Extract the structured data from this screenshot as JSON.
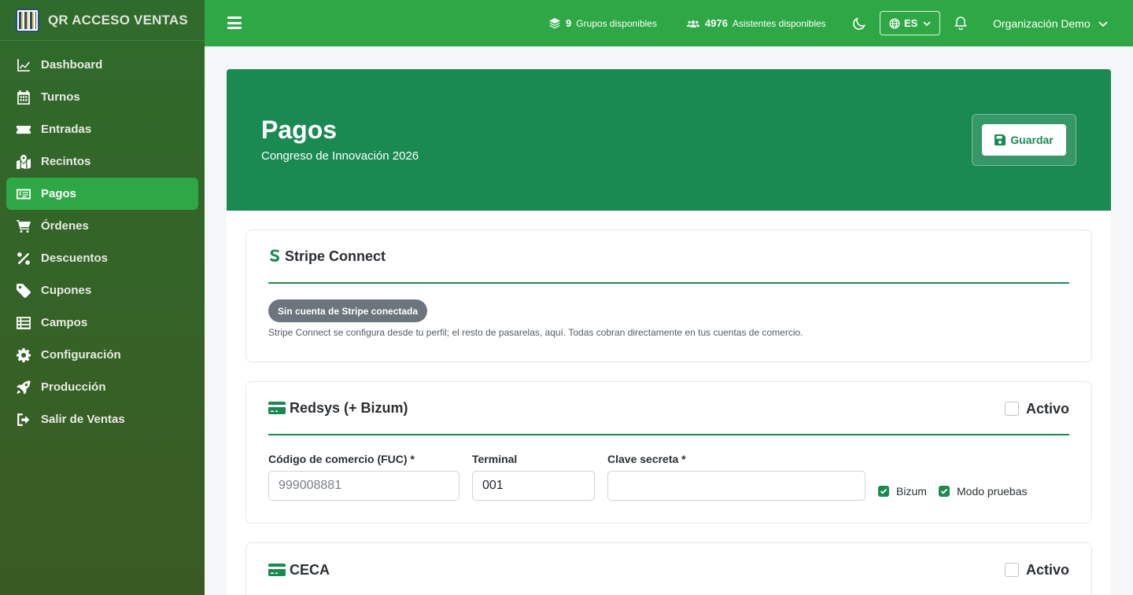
{
  "brand": {
    "name": "QR ACCESO VENTAS"
  },
  "sidebar": {
    "items": [
      {
        "label": "Dashboard",
        "icon": "chart-line-icon"
      },
      {
        "label": "Turnos",
        "icon": "calendar-icon"
      },
      {
        "label": "Entradas",
        "icon": "ticket-icon"
      },
      {
        "label": "Recintos",
        "icon": "map-marked-icon"
      },
      {
        "label": "Pagos",
        "icon": "money-check-icon",
        "active": true
      },
      {
        "label": "Órdenes",
        "icon": "cart-icon"
      },
      {
        "label": "Descuentos",
        "icon": "percent-icon"
      },
      {
        "label": "Cupones",
        "icon": "tags-icon"
      },
      {
        "label": "Campos",
        "icon": "list-icon"
      },
      {
        "label": "Configuración",
        "icon": "gear-icon"
      },
      {
        "label": "Producción",
        "icon": "rocket-icon"
      },
      {
        "label": "Salir de Ventas",
        "icon": "sign-out-icon"
      }
    ]
  },
  "topbar": {
    "groups_count": "9",
    "groups_label": "Grupos disponibles",
    "attendees_count": "4976",
    "attendees_label": "Asistentes disponibles",
    "language": "ES",
    "organization": "Organización Demo"
  },
  "hero": {
    "title": "Pagos",
    "subtitle": "Congreso de Innovación 2026",
    "save_label": "Guardar"
  },
  "stripe": {
    "title": "Stripe Connect",
    "badge": "Sin cuenta de Stripe conectada",
    "hint": "Stripe Connect se configura desde tu perfil; el resto de pasarelas, aquí. Todas cobran directamente en tus cuentas de comercio."
  },
  "redsys": {
    "title": "Redsys (+ Bizum)",
    "active_label": "Activo",
    "fuc_label": "Código de comercio (FUC) *",
    "fuc_placeholder": "999008881",
    "terminal_label": "Terminal",
    "terminal_value": "001",
    "secret_label": "Clave secreta *",
    "bizum_label": "Bizum",
    "test_label": "Modo pruebas"
  },
  "ceca": {
    "title": "CECA",
    "active_label": "Activo"
  },
  "colors": {
    "primary": "#2ea844",
    "hero": "#1b8a52",
    "sidebar": "#2f6b2c"
  }
}
